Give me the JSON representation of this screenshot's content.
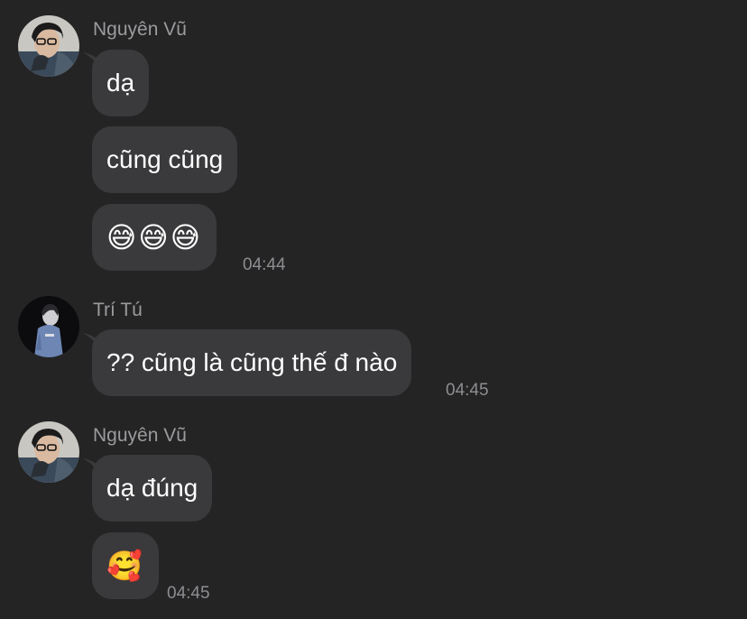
{
  "groups": [
    {
      "sender": "Nguyên Vũ",
      "avatar": "avatar-nguyen-vu",
      "messages": [
        {
          "text": "dạ"
        },
        {
          "text": "cũng cũng"
        },
        {
          "text": "😅😅😅",
          "time": "04:44"
        }
      ]
    },
    {
      "sender": "Trí Tú",
      "avatar": "avatar-tri-tu",
      "messages": [
        {
          "text": "?? cũng là cũng thế đ nào",
          "time": "04:45"
        }
      ]
    },
    {
      "sender": "Nguyên Vũ",
      "avatar": "avatar-nguyen-vu",
      "messages": [
        {
          "text": "dạ đúng"
        },
        {
          "text": "🥰",
          "time": "04:45"
        }
      ]
    }
  ],
  "colors": {
    "background": "#242425",
    "bubble": "#3a3a3c",
    "sender_text": "#9b9b9e",
    "message_text": "#ffffff",
    "timestamp": "#8e8e92"
  }
}
